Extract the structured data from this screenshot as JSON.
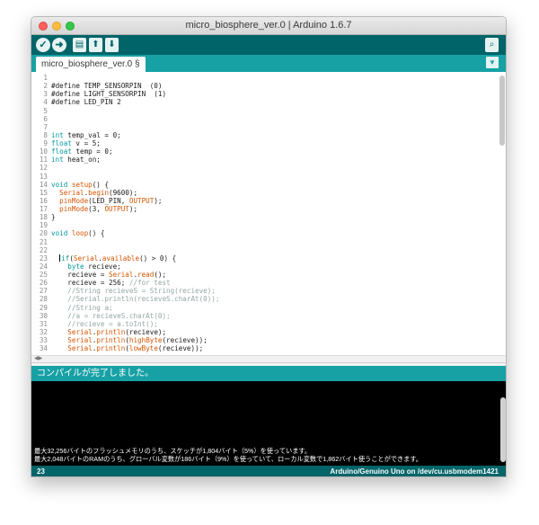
{
  "window": {
    "title": "micro_biosphere_ver.0 | Arduino 1.6.7"
  },
  "toolbar": {
    "verify_icon": "checkmark-icon",
    "upload_icon": "arrow-right-icon",
    "new_icon": "document-icon",
    "open_icon": "arrow-up-icon",
    "save_icon": "arrow-down-icon",
    "serial_monitor_icon": "magnifier-icon"
  },
  "tab": {
    "label": "micro_biosphere_ver.0 §",
    "menu_icon": "triangle-down-icon"
  },
  "editor": {
    "lines": [
      {
        "n": "1",
        "t": ""
      },
      {
        "n": "2",
        "t": "#define TEMP_SENSORPIN  (0)"
      },
      {
        "n": "3",
        "t": "#define LIGHT_SENSORPIN  (1)"
      },
      {
        "n": "4",
        "t": "#define LED_PIN 2"
      },
      {
        "n": "5",
        "t": ""
      },
      {
        "n": "6",
        "t": ""
      },
      {
        "n": "7",
        "t": ""
      },
      {
        "n": "8",
        "t": "int temp_val = 0;"
      },
      {
        "n": "9",
        "t": "float v = 5;"
      },
      {
        "n": "10",
        "t": "float temp = 0;"
      },
      {
        "n": "11",
        "t": "int heat_on;"
      },
      {
        "n": "12",
        "t": ""
      },
      {
        "n": "13",
        "t": ""
      },
      {
        "n": "14",
        "t": "void setup() {"
      },
      {
        "n": "15",
        "t": "  Serial.begin(9600);"
      },
      {
        "n": "16",
        "t": "  pinMode(LED_PIN, OUTPUT);"
      },
      {
        "n": "17",
        "t": "  pinMode(3, OUTPUT);"
      },
      {
        "n": "18",
        "t": "}"
      },
      {
        "n": "19",
        "t": ""
      },
      {
        "n": "20",
        "t": "void loop() {"
      },
      {
        "n": "21",
        "t": ""
      },
      {
        "n": "22",
        "t": ""
      },
      {
        "n": "23",
        "t": "   if(Serial.available() > 0) {"
      },
      {
        "n": "24",
        "t": "    byte recieve;"
      },
      {
        "n": "25",
        "t": "    recieve = Serial.read();"
      },
      {
        "n": "26",
        "t": "    recieve = 256; //for test"
      },
      {
        "n": "27",
        "t": "    //String recieveS = String(recieve);"
      },
      {
        "n": "28",
        "t": "    //Serial.println(recieveS.charAt(0));"
      },
      {
        "n": "29",
        "t": "    //String a;"
      },
      {
        "n": "30",
        "t": "    //a = recieveS.charAt(0);"
      },
      {
        "n": "31",
        "t": "    //recieve = a.toInt();"
      },
      {
        "n": "32",
        "t": "    Serial.println(recieve);"
      },
      {
        "n": "33",
        "t": "    Serial.println(highByte(recieve));"
      },
      {
        "n": "34",
        "t": "    Serial.println(lowByte(recieve));"
      }
    ]
  },
  "status": {
    "message": "コンパイルが完了しました。"
  },
  "console": {
    "line1": "最大32,256バイトのフラッシュメモリのうち、スケッチが1,804バイト（5%）を使っています。",
    "line2": "最大2,048バイトのRAMのうち、グローバル変数が186バイト（9%）を使っていて、ローカル変数で1,862バイト使うことができます。"
  },
  "footer": {
    "line_number": "23",
    "board": "Arduino/Genuino Uno on /dev/cu.usbmodem1421"
  },
  "colors": {
    "toolbar": "#006468",
    "tabbar": "#17a1a5",
    "keyword": "#00979c",
    "function": "#d35400",
    "console": "#000000"
  }
}
